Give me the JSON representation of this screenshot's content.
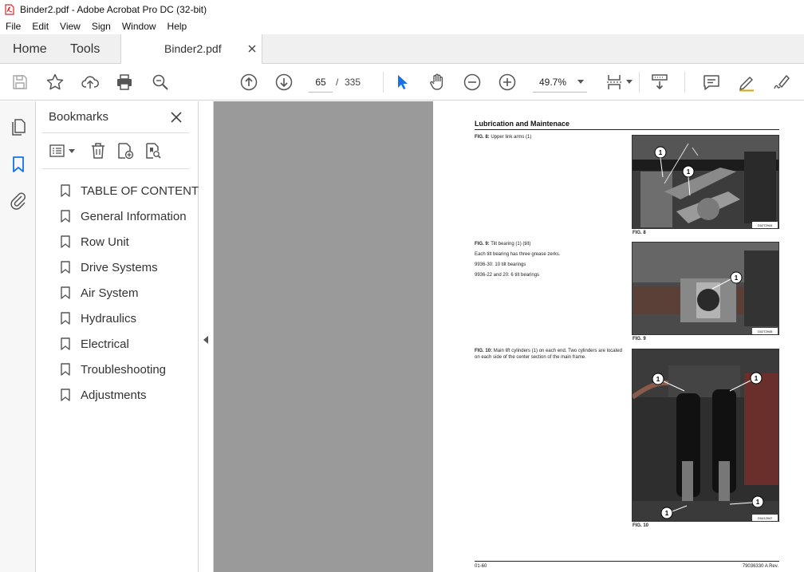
{
  "window": {
    "title": "Binder2.pdf - Adobe Acrobat Pro DC (32-bit)"
  },
  "menu": [
    "File",
    "Edit",
    "View",
    "Sign",
    "Window",
    "Help"
  ],
  "tabs": {
    "home": "Home",
    "tools": "Tools",
    "document": "Binder2.pdf"
  },
  "toolbar": {
    "current_page": "65",
    "page_separator": "/",
    "total_pages": "335",
    "zoom": "49.7%"
  },
  "bookmarks": {
    "title": "Bookmarks",
    "items": [
      "TABLE OF CONTENT",
      "General Information",
      "Row Unit",
      "Drive Systems",
      "Air System",
      "Hydraulics",
      "Electrical",
      "Troubleshooting",
      "Adjustments"
    ]
  },
  "page": {
    "heading": "Lubrication and Maintenace",
    "fig8": {
      "caption_bold": "FIG. 8:",
      "caption": " Upper link arms (1)",
      "label": "FIG. 8",
      "tag": "G0272944",
      "callout": "1"
    },
    "fig9": {
      "caption_bold": "FIG. 9:",
      "caption": " Tilt bearing (1) (tilt)",
      "line1": "Each tilt bearing has three grease zerks.",
      "line2": "9936-30: 10 tilt bearings",
      "line3": "9936-22 and 20: 6 tilt bearings",
      "label": "FIG. 9",
      "tag": "G0272945",
      "callout": "1"
    },
    "fig10": {
      "caption_bold": "FIG. 10:",
      "caption": " Main lift cylinders (1) on each end. Two cylinders are located on each side of the center section of the main frame.",
      "label": "FIG. 10",
      "tag": "G0412947",
      "callout": "1"
    },
    "footer_left": "01-60",
    "footer_right": "79036330 A Rev."
  },
  "colors": {
    "acrobat_red": "#d4282a",
    "icon_gray": "#555555",
    "select_blue": "#1473e6"
  }
}
